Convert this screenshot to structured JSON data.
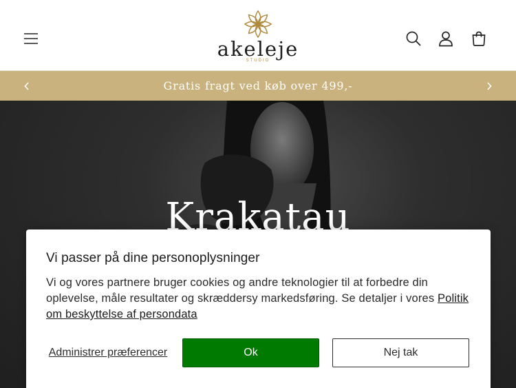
{
  "header": {
    "logo_text": "akeleje",
    "logo_subtext": "STUDIO",
    "icons": [
      "menu-icon",
      "flower-logo-icon",
      "search-icon",
      "account-icon",
      "cart-icon"
    ]
  },
  "announcement": {
    "text": "Gratis fragt ved køb over 499,-",
    "icons": [
      "chevron-left-icon",
      "chevron-right-icon"
    ]
  },
  "hero": {
    "title": "Krakatau"
  },
  "cookie_banner": {
    "title": "Vi passer på dine personoplysninger",
    "body": "Vi og vores partnere bruger cookies og andre teknologier til at forbedre din oplevelse, måle resultater og skræddersy markedsføring. Se detaljer i vores ",
    "policy_link": "Politik om beskyttelse af persondata",
    "preferences_label": "Administrer præferencer",
    "ok_label": "Ok",
    "decline_label": "Nej tak"
  },
  "colors": {
    "announcement_bg": "#c9b27e",
    "brand_gold": "#b08a3c",
    "ok_green": "#007a00",
    "hero_bg": "#2a2a2a"
  }
}
